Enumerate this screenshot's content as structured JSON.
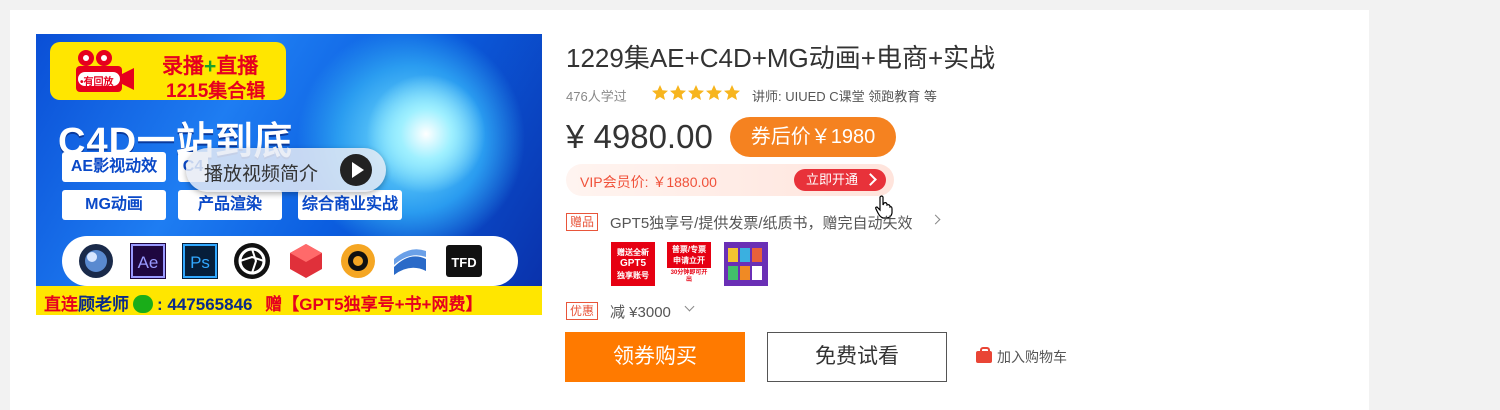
{
  "banner": {
    "badge_replay": "•有回放",
    "badge_line1_a": "录播",
    "badge_line1_plus": "+",
    "badge_line1_b": "直播",
    "badge_line2": "1215集合辑",
    "headline": "C4D一站到底",
    "tags": [
      "AE影视动效",
      "C4",
      "MG动画",
      "产品渲染",
      "综合商业实战"
    ],
    "play_label": "播放视频简介",
    "software_icons": [
      "cinema4d-icon",
      "after-effects-icon",
      "photoshop-icon",
      "octane-icon",
      "redshift-icon",
      "arnold-icon",
      "c4d-logo-icon",
      "tfd-icon"
    ],
    "ae_text": "Ae",
    "ps_text": "Ps",
    "tfd_text": "TFD",
    "contact_prefix": "直连",
    "contact_name": "顾老师",
    "contact_number": ": 447565846",
    "contact_gift_a": "赠【GPT5独享号",
    "contact_gift_b": "+书+",
    "contact_gift_c": "网费】"
  },
  "course": {
    "title": "1229集AE+C4D+MG动画+电商+实战",
    "learners": "476人学过",
    "rating_stars": 5,
    "teacher": "讲师: UIUED C课堂 领跑教育 等",
    "price": "¥ 4980.00",
    "coupon_price": "券后价￥1980",
    "vip_price": "VIP会员价: ￥1880.00",
    "vip_button": "立即开通",
    "gift_tag": "赠品",
    "gift_text": "GPT5独享号/提供发票/纸质书，赠完自动失效",
    "gift_thumbs": [
      {
        "lines": [
          "赠送全新",
          "GPT5",
          "独享账号"
        ]
      },
      {
        "lines": [
          "普票/专票",
          "申请立开",
          "30分钟即可开出"
        ]
      },
      {
        "lines": []
      }
    ],
    "discount_tag": "优惠",
    "discount_text": "减 ¥3000",
    "buy_button": "领券购买",
    "trial_button": "免费试看",
    "cart_label": "加入购物车"
  },
  "colors": {
    "accent_orange": "#ff7a00",
    "vip_red": "#e8323a",
    "star_yellow": "#f7b51e"
  }
}
